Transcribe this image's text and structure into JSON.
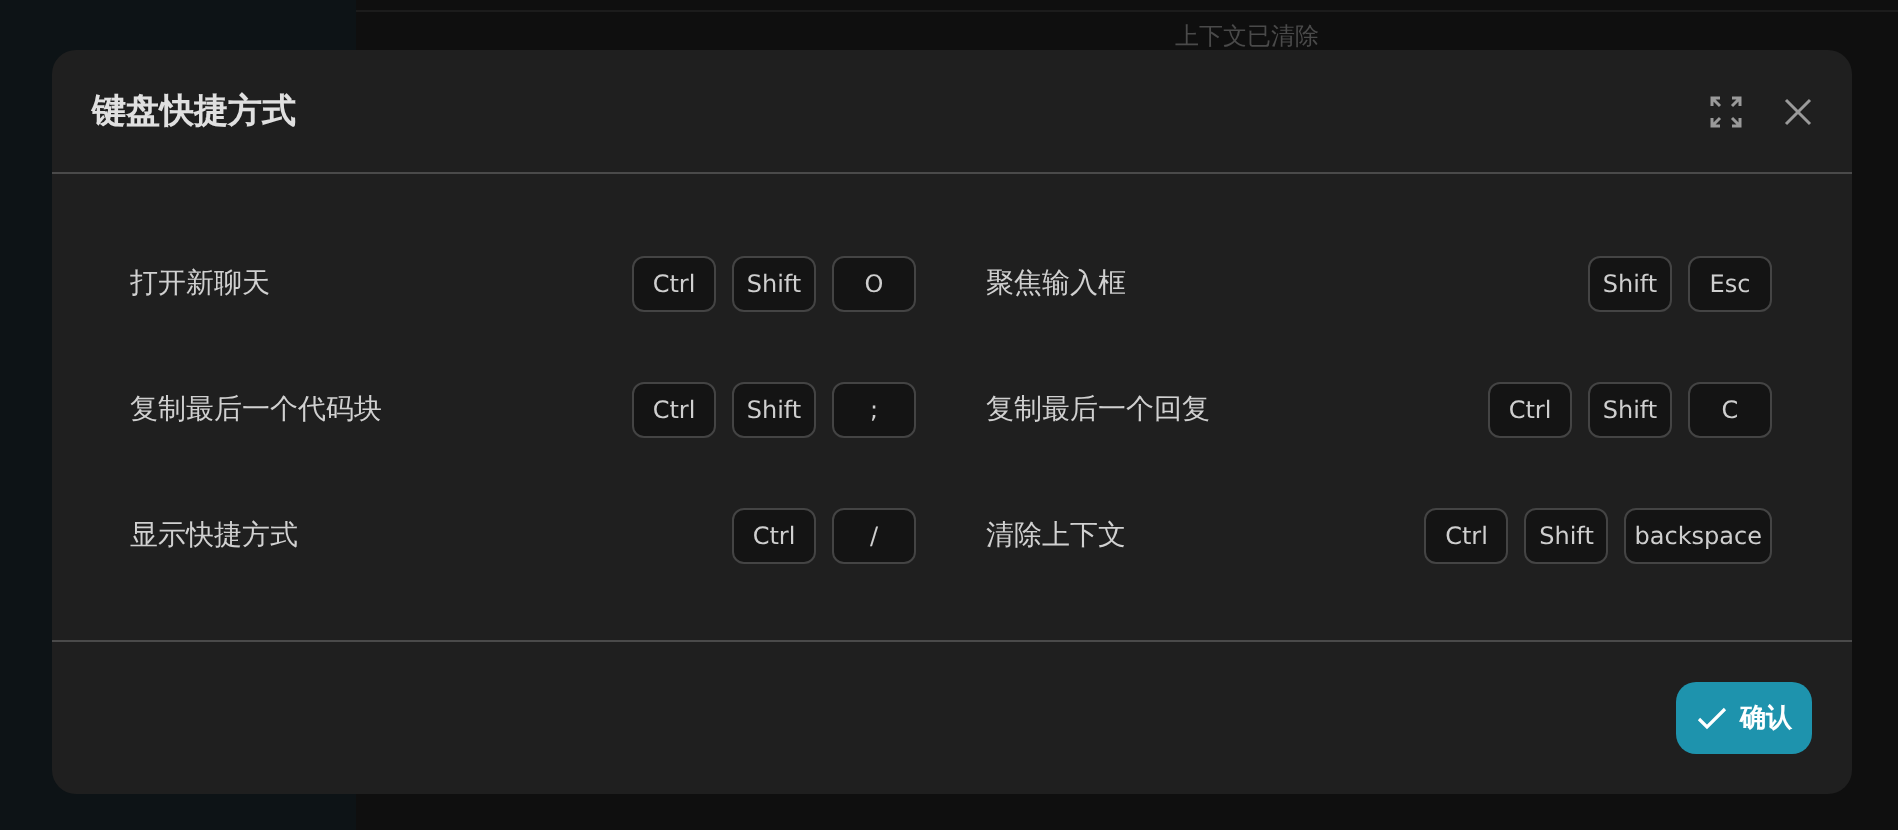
{
  "toast": {
    "text": "上下文已清除"
  },
  "dialog": {
    "title": "键盘快捷方式",
    "shortcuts": [
      {
        "label": "打开新聊天",
        "keys": [
          "Ctrl",
          "Shift",
          "O"
        ]
      },
      {
        "label": "聚焦输入框",
        "keys": [
          "Shift",
          "Esc"
        ]
      },
      {
        "label": "复制最后一个代码块",
        "keys": [
          "Ctrl",
          "Shift",
          ";"
        ]
      },
      {
        "label": "复制最后一个回复",
        "keys": [
          "Ctrl",
          "Shift",
          "C"
        ]
      },
      {
        "label": "显示快捷方式",
        "keys": [
          "Ctrl",
          "/"
        ]
      },
      {
        "label": "清除上下文",
        "keys": [
          "Ctrl",
          "Shift",
          "backspace"
        ]
      }
    ],
    "confirm_button": "确认"
  }
}
